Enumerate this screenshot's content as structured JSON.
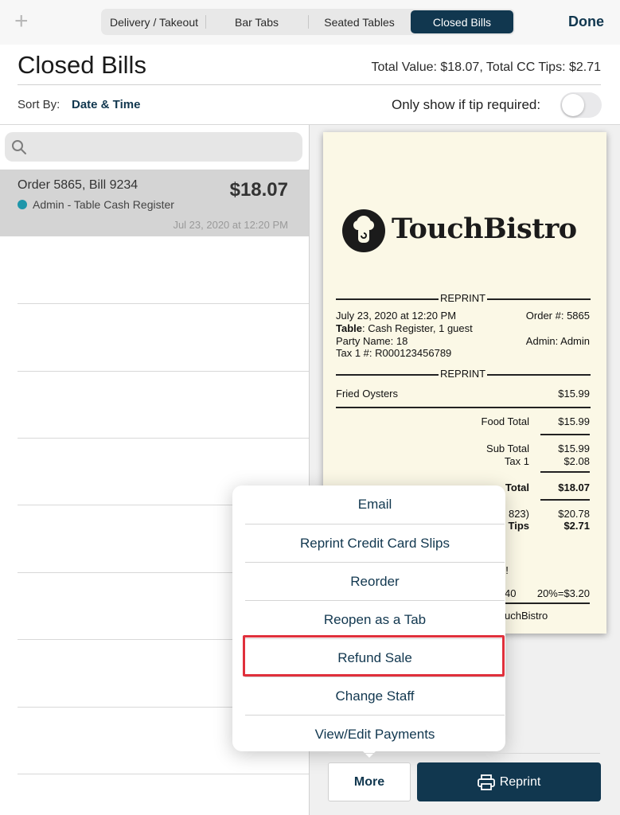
{
  "topbar": {
    "add_icon": "plus-icon",
    "segments": [
      "Delivery / Takeout",
      "Bar Tabs",
      "Seated Tables",
      "Closed Bills"
    ],
    "active_segment": "Closed Bills",
    "done": "Done"
  },
  "header": {
    "title": "Closed Bills",
    "totals": "Total Value: $18.07, Total CC Tips: $2.71",
    "sort_label": "Sort By:",
    "sort_value": "Date & Time",
    "tip_filter_label": "Only show if tip required:",
    "tip_filter_on": false
  },
  "search": {
    "placeholder": "",
    "icon": "search-icon"
  },
  "bills": [
    {
      "title": "Order 5865, Bill 9234",
      "amount": "$18.07",
      "staff": "Admin - Table Cash Register",
      "date": "Jul 23, 2020 at 12:20 PM",
      "status_color": "#1f96aa"
    }
  ],
  "receipt": {
    "brand": "TouchBistro",
    "reprint": "REPRINT",
    "date": "July 23, 2020 at 12:20 PM",
    "order": "Order #: 5865",
    "table_label": "Table",
    "table_value": ": Cash Register, 1 guest",
    "party": "Party Name: 18",
    "admin": "Admin: Admin",
    "tax_id": "Tax 1 #: R000123456789",
    "item_name": "Fried Oysters",
    "item_price": "$15.99",
    "food_total_label": "Food Total",
    "food_total": "$15.99",
    "subtotal_label": "Sub Total",
    "subtotal": "$15.99",
    "tax_label": "Tax 1",
    "tax": "$2.08",
    "total_label": "Total",
    "total": "$18.07",
    "card_partial": "823)",
    "card_amount": "$20.78",
    "tips_label": "Tips",
    "tips": "$2.71",
    "thanks_partial": "n!",
    "tip_suggest_partial": "40",
    "tip_suggest": "20%=$3.20",
    "footer_partial": "uchBistro"
  },
  "popover": {
    "items": [
      "Email",
      "Reprint Credit Card Slips",
      "Reorder",
      "Reopen as a Tab",
      "Refund Sale",
      "Change Staff",
      "View/Edit Payments"
    ],
    "highlighted": "Refund Sale"
  },
  "actions": {
    "more": "More",
    "reprint": "Reprint",
    "reprint_icon": "printer-icon"
  },
  "colors": {
    "accent": "#11374f",
    "highlight": "#e0303c",
    "receipt_paper": "#fbf8e6"
  }
}
